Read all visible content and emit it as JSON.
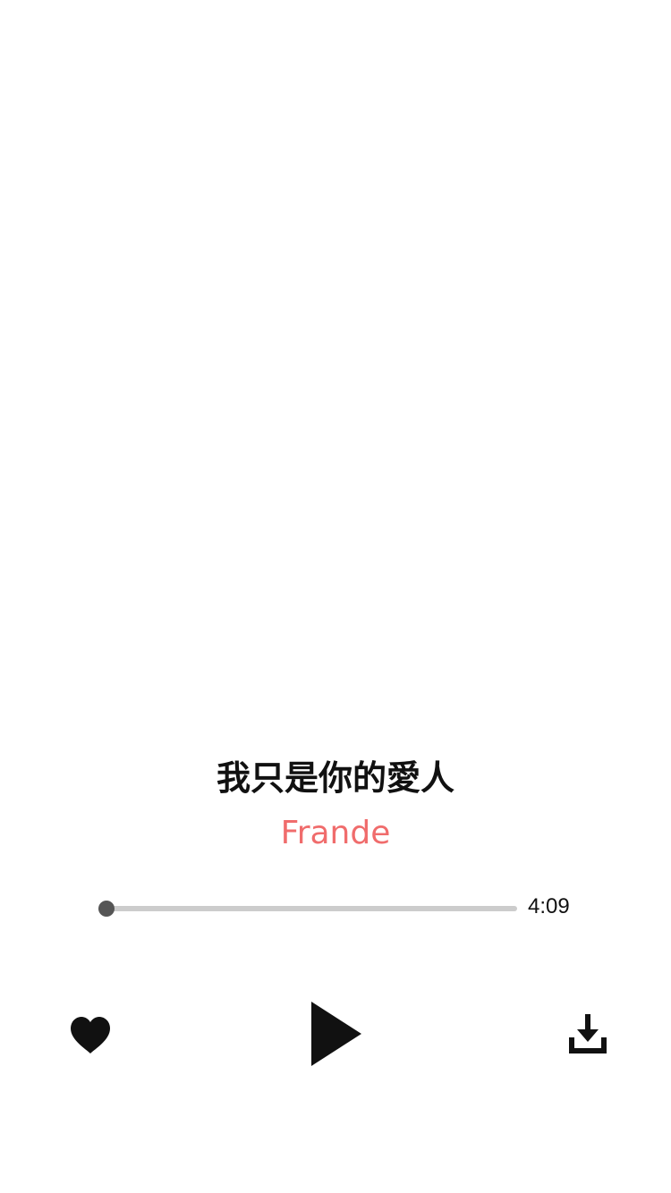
{
  "song": {
    "title": "我只是你的愛人",
    "artist": "Frande"
  },
  "player": {
    "progress_fraction": 0.0,
    "duration": "4:09"
  },
  "controls": {
    "like_icon": "heart-icon",
    "play_icon": "play-icon",
    "download_icon": "download-icon"
  },
  "colors": {
    "title": "#111111",
    "artist": "#F06C6C",
    "track": "#CCCCCC",
    "thumb": "#555555",
    "icon": "#111111"
  }
}
